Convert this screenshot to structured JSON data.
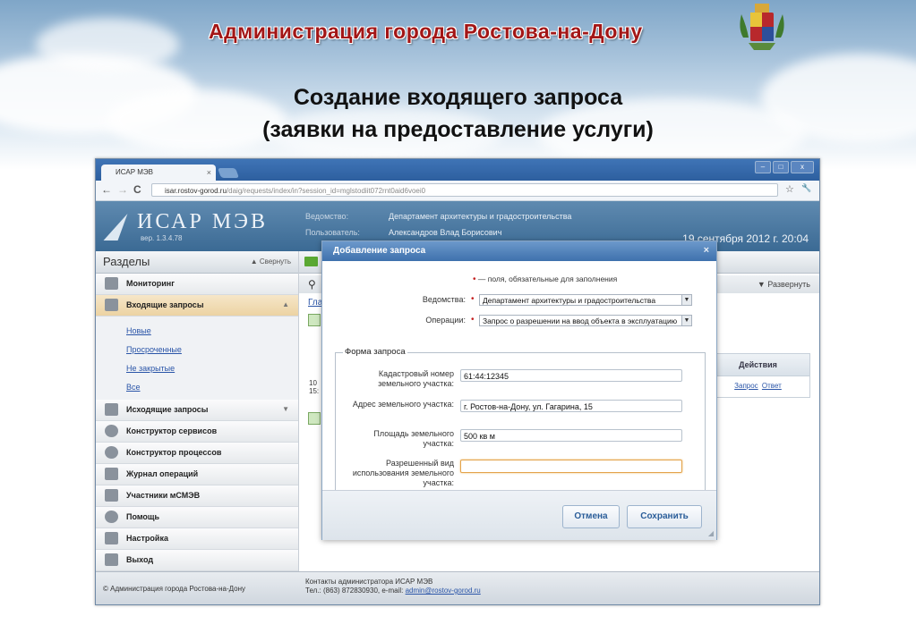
{
  "slide": {
    "org_title": "Администрация города Ростова-на-Дону",
    "title_line1": "Создание входящего запроса",
    "title_line2": "(заявки на предоставление услуги)"
  },
  "browser": {
    "tab_title": "ИСАР МЭВ",
    "tab_close": "×",
    "url_host": "isar.rostov-gorod.ru",
    "url_path": "/daig/requests/index/in?session_id=mglstodiit072rnt0aid6voei0",
    "back": "←",
    "forward": "→",
    "reload": "C",
    "star": "☆",
    "wrench": "🔧"
  },
  "app": {
    "logo": "ИСАР МЭВ",
    "version": "вер. 1.3.4.78",
    "dept_label": "Ведомство:",
    "dept_value": "Департамент архитектуры и градостроительства",
    "user_label": "Пользователь:",
    "user_value": "Александров Влад Борисович",
    "date": "19 сентября 2012 г.   20:04"
  },
  "sidebar": {
    "title": "Разделы",
    "collapse": "Свернуть",
    "items": [
      {
        "label": "Мониторинг"
      },
      {
        "label": "Входящие запросы"
      },
      {
        "label": "Исходящие запросы"
      },
      {
        "label": "Конструктор сервисов"
      },
      {
        "label": "Конструктор процессов"
      },
      {
        "label": "Журнал операций"
      },
      {
        "label": "Участники мСМЭВ"
      },
      {
        "label": "Помощь"
      },
      {
        "label": "Настройка"
      },
      {
        "label": "Выход"
      }
    ],
    "sub_items": [
      {
        "label": "Новые"
      },
      {
        "label": "Просроченные"
      },
      {
        "label": "Не закрытые"
      },
      {
        "label": "Все"
      }
    ]
  },
  "main": {
    "expand": "Развернуть",
    "crumb": "Гла",
    "row_date_1": "10",
    "row_date_2": "15:",
    "actions_header": "Действия",
    "action_request": "Запрос",
    "action_answer": "Ответ"
  },
  "footer": {
    "copyright": "© Администрация города Ростова-на-Дону",
    "contacts": "Контакты администратора ИСАР МЭВ",
    "phone": "Тел.: (863) 872830930, e-mail:",
    "email": "admin@rostov-gorod.ru"
  },
  "modal": {
    "title": "Добавление запроса",
    "close": "×",
    "required_note": "— поля, обязательные для заполнения",
    "dept_label": "Ведомства:",
    "dept_value": "Департамент архитектуры и градостроительства",
    "ops_label": "Операции:",
    "ops_value": "Запрос о разрешении на ввод объекта в эксплуатацию",
    "form_legend": "Форма запроса",
    "fields": [
      {
        "label": "Кадастровый номер земельного участка:",
        "value": "61:44:12345"
      },
      {
        "label": "Адрес земельного участка:",
        "value": "г. Ростов-на-Дону, ул. Гагарина, 15"
      },
      {
        "label": "Площадь земельного участка:",
        "value": "500 кв м"
      },
      {
        "label": "Разрешенный вид использования земельного участка:",
        "value": ""
      }
    ],
    "cancel": "Отмена",
    "save": "Сохранить"
  }
}
